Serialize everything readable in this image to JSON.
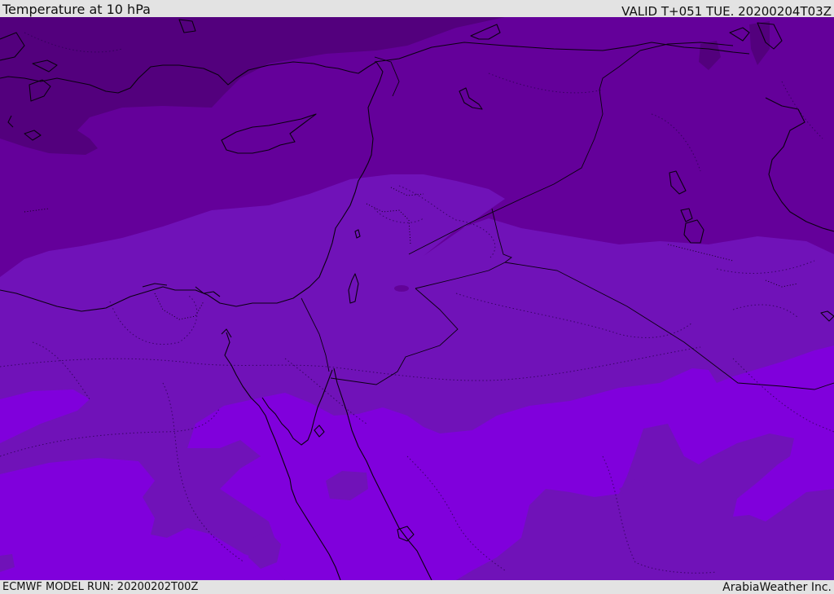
{
  "header": {
    "title": "Temperature at 10 hPa",
    "valid_time": "VALID T+051 TUE. 20200204T03Z"
  },
  "footer": {
    "model_run": "ECMWF MODEL RUN: 20200202T00Z",
    "credit": "ArabiaWeather Inc."
  },
  "map": {
    "field": "temperature",
    "pressure_level": "10 hPa",
    "colors": {
      "band_darkest": "#53007d",
      "band_dark": "#64009a",
      "band_mid": "#7012b8",
      "band_light": "#8000dc",
      "coastline": "#0a0010",
      "border": "#0a0010"
    }
  }
}
